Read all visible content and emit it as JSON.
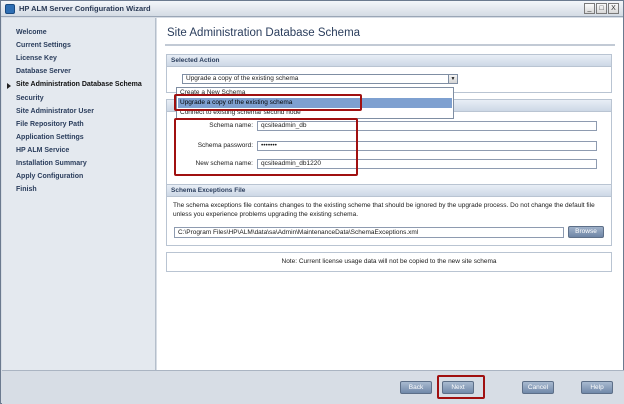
{
  "window": {
    "title": "HP ALM Server Configuration Wizard",
    "controls": [
      "_",
      "□",
      "X"
    ]
  },
  "nav": {
    "items": [
      {
        "label": "Welcome"
      },
      {
        "label": "Current Settings"
      },
      {
        "label": "License Key"
      },
      {
        "label": "Database Server"
      },
      {
        "label": "Site Administration Database Schema",
        "active": true
      },
      {
        "label": "Security"
      },
      {
        "label": "Site Administrator User"
      },
      {
        "label": "File Repository Path"
      },
      {
        "label": "Application Settings"
      },
      {
        "label": "HP ALM Service"
      },
      {
        "label": "Installation Summary"
      },
      {
        "label": "Apply Configuration"
      },
      {
        "label": "Finish"
      }
    ]
  },
  "main": {
    "page_title": "Site Administration Database Schema",
    "selected_action": {
      "heading": "Selected Action",
      "value": "Upgrade a copy of the existing schema",
      "options": [
        "Create a New Schema",
        "Upgrade a copy of the existing schema",
        "Connect to existing schema/ second node"
      ],
      "selected_index": 1
    },
    "schema": {
      "name_label": "Schema name:",
      "name_value": "qcsiteadmin_db",
      "password_label": "Schema password:",
      "password_value": "•••••••",
      "new_name_label": "New schema name:",
      "new_name_value": "qcsiteadmin_db1220"
    },
    "exceptions": {
      "heading": "Schema Exceptions File",
      "description": "The schema exceptions file contains changes to the existing scheme that should be ignored by the upgrade process. Do not change the default file unless you experience problems upgrading the existing schema.",
      "path": "C:\\Program Files\\HP\\ALM\\data\\sa\\Admin\\MaintenanceData\\SchemaExceptions.xml",
      "browse_label": "Browse"
    },
    "note": "Note: Current license usage data will not be copied to the new site schema"
  },
  "footer": {
    "back_label": "Back",
    "next_label": "Next",
    "cancel_label": "Cancel",
    "help_label": "Help"
  },
  "colors": {
    "highlight_box": "#a01010",
    "selected_option": "#7ea0d0",
    "button": "#7189a9"
  }
}
